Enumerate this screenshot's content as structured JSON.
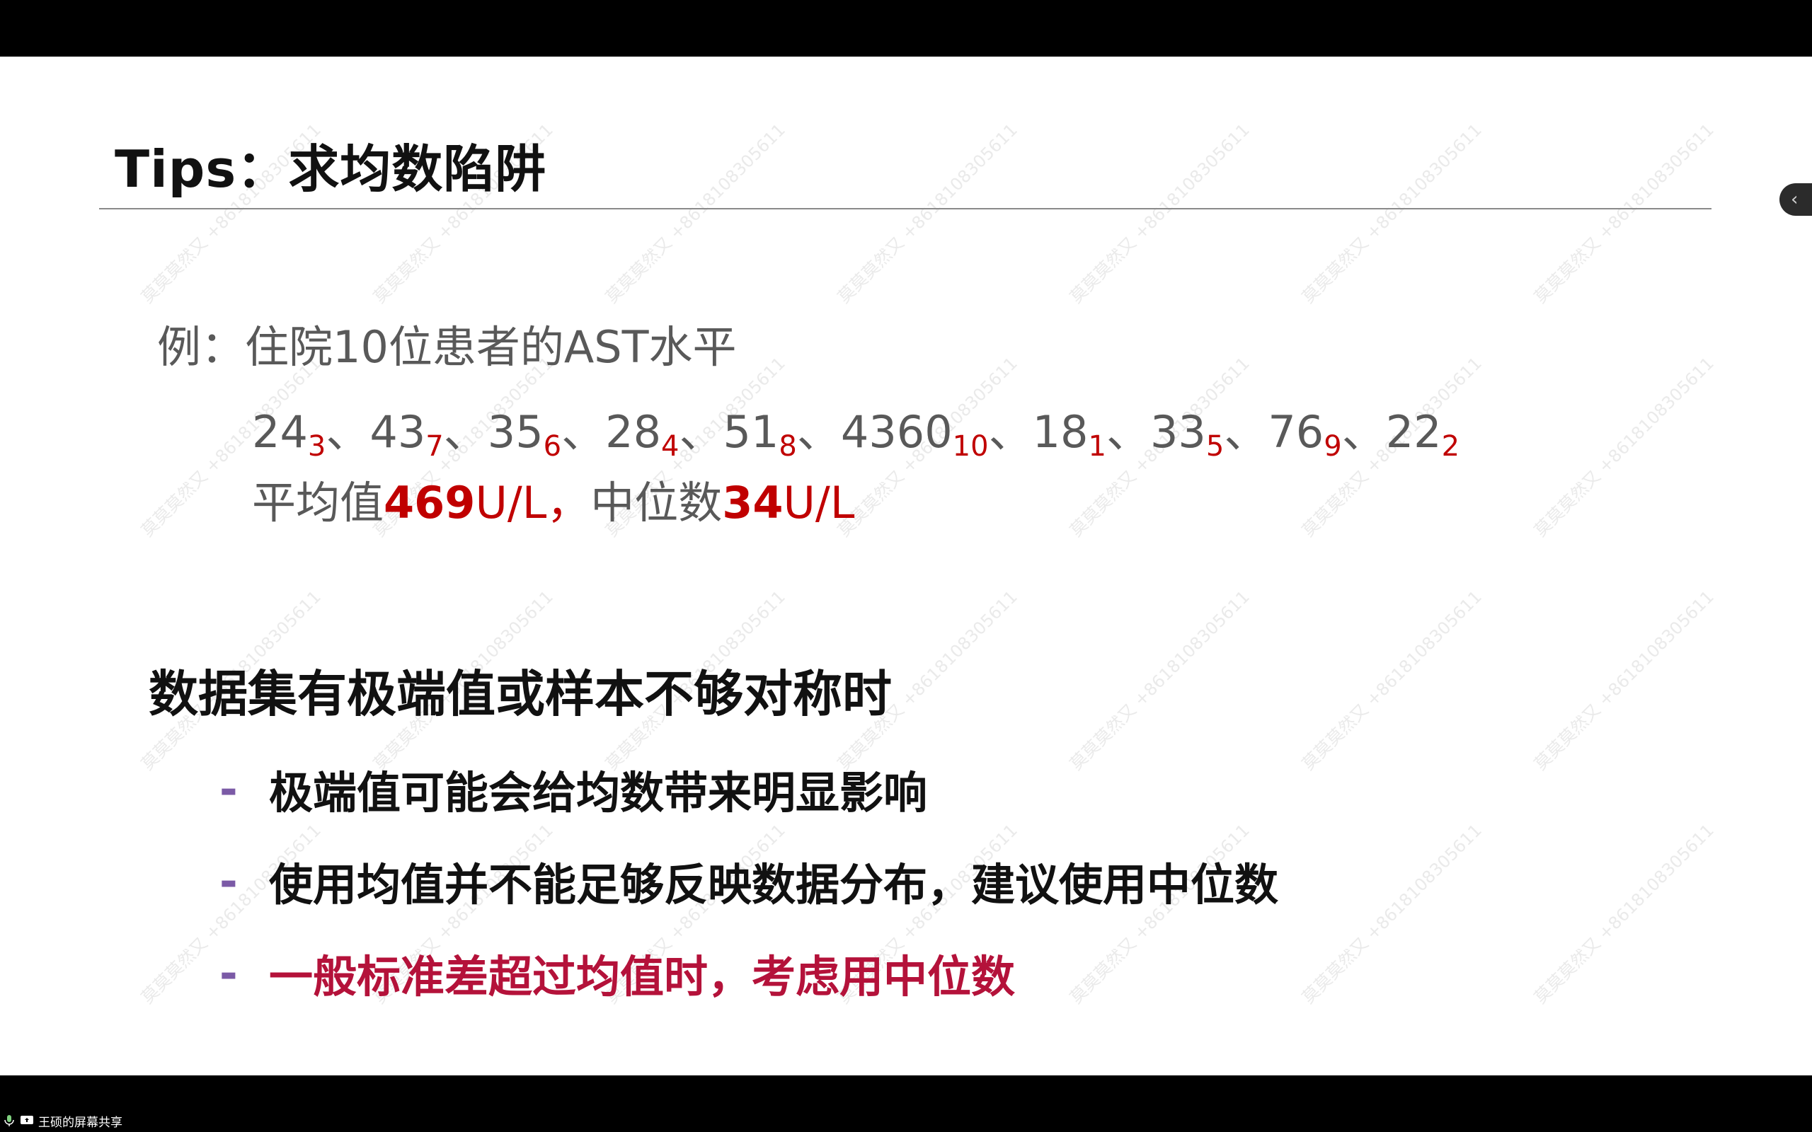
{
  "slide": {
    "title": "Tips：求均数陷阱",
    "example": "例：住院10位患者的AST水平",
    "data_values": [
      {
        "value": "24",
        "rank": "3"
      },
      {
        "value": "43",
        "rank": "7"
      },
      {
        "value": "35",
        "rank": "6"
      },
      {
        "value": "28",
        "rank": "4"
      },
      {
        "value": "51",
        "rank": "8"
      },
      {
        "value": "4360",
        "rank": "10"
      },
      {
        "value": "18",
        "rank": "1"
      },
      {
        "value": "33",
        "rank": "5"
      },
      {
        "value": "76",
        "rank": "9"
      },
      {
        "value": "22",
        "rank": "2"
      }
    ],
    "separator": "、",
    "summary": {
      "mean_label": "平均值",
      "mean_value": "469",
      "mean_unit": "U/L，",
      "median_label": "中位数",
      "median_value": "34",
      "median_unit": "U/L"
    },
    "section_heading": "数据集有极端值或样本不够对称时",
    "bullets": [
      {
        "dash": "-",
        "text": "极端值可能会给均数带来明显影响"
      },
      {
        "dash": "-",
        "text": "使用均值并不能足够反映数据分布，建议使用中位数"
      },
      {
        "dash": "-",
        "text": "一般标准差超过均值时，考虑用中位数"
      }
    ],
    "watermark": "莫莫莫然又 +8618108305611"
  },
  "taskbar": {
    "share_label": "王硕的屏幕共享"
  },
  "side_tab": {
    "icon": "chevron-left-icon",
    "glyph": "‹"
  },
  "colors": {
    "highlight_red": "#c00000",
    "bullet_red": "#b4123a",
    "dash_purple": "#7b5aa6",
    "text_gray": "#595959"
  }
}
